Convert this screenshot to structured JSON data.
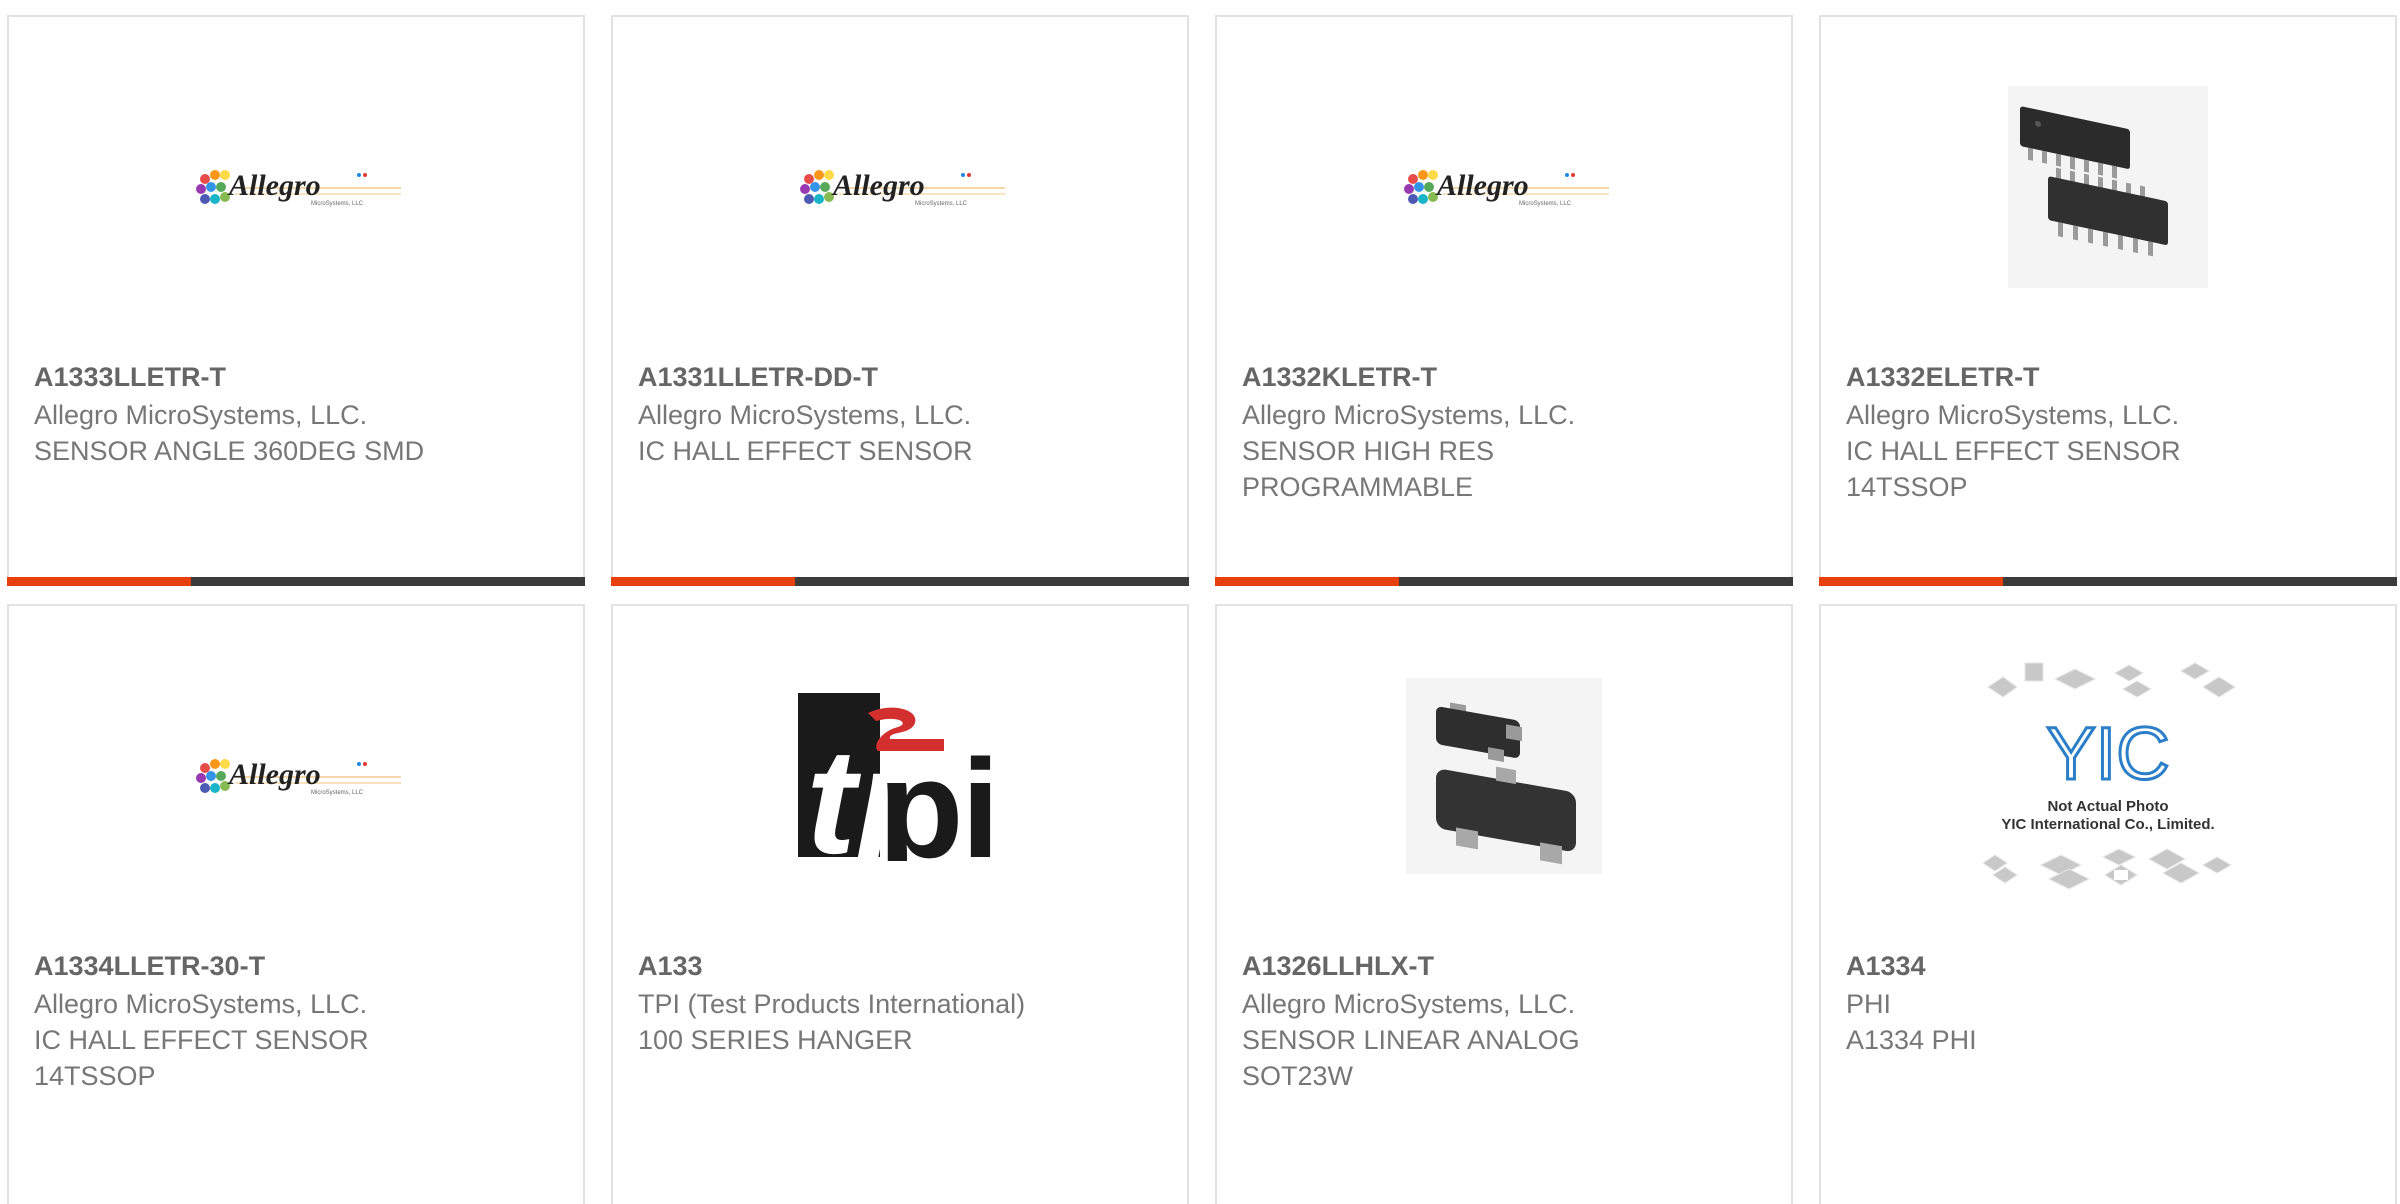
{
  "colors": {
    "accent": "#e8400c",
    "bar": "#3b3b3b",
    "border": "#e2e2e2",
    "title": "#666666",
    "text": "#777777"
  },
  "products": [
    {
      "part_number": "A1333LLETR-T",
      "manufacturer": "Allegro MicroSystems, LLC.",
      "description": [
        "SENSOR ANGLE 360DEG SMD"
      ],
      "image": "allegro-logo",
      "logo_text": "Allegro",
      "logo_subtext": "MicroSystems, LLC"
    },
    {
      "part_number": "A1331LLETR-DD-T",
      "manufacturer": "Allegro MicroSystems, LLC.",
      "description": [
        "IC HALL EFFECT SENSOR"
      ],
      "image": "allegro-logo",
      "logo_text": "Allegro",
      "logo_subtext": "MicroSystems, LLC"
    },
    {
      "part_number": "A1332KLETR-T",
      "manufacturer": "Allegro MicroSystems, LLC.",
      "description": [
        "SENSOR HIGH RES",
        "PROGRAMMABLE"
      ],
      "image": "allegro-logo",
      "logo_text": "Allegro",
      "logo_subtext": "MicroSystems, LLC"
    },
    {
      "part_number": "A1332ELETR-T",
      "manufacturer": "Allegro MicroSystems, LLC.",
      "description": [
        "IC HALL EFFECT SENSOR",
        "14TSSOP"
      ],
      "image": "tssop-package"
    },
    {
      "part_number": "A1334LLETR-30-T",
      "manufacturer": "Allegro MicroSystems, LLC.",
      "description": [
        "IC HALL EFFECT SENSOR",
        "14TSSOP"
      ],
      "image": "allegro-logo",
      "logo_text": "Allegro",
      "logo_subtext": "MicroSystems, LLC"
    },
    {
      "part_number": "A133",
      "manufacturer": "TPI (Test Products International)",
      "description": [
        "100 SERIES HANGER"
      ],
      "image": "tpi-logo",
      "logo_text": "tpi"
    },
    {
      "part_number": "A1326LLHLX-T",
      "manufacturer": "Allegro MicroSystems, LLC.",
      "description": [
        "SENSOR LINEAR ANALOG",
        "SOT23W"
      ],
      "image": "sot23-package"
    },
    {
      "part_number": "A1334",
      "manufacturer": "PHI",
      "description": [
        "A1334 PHI"
      ],
      "image": "yic-placeholder",
      "logo_text": "YIC",
      "placeholder_line1": "Not Actual Photo",
      "placeholder_line2": "YIC International Co., Limited."
    }
  ]
}
